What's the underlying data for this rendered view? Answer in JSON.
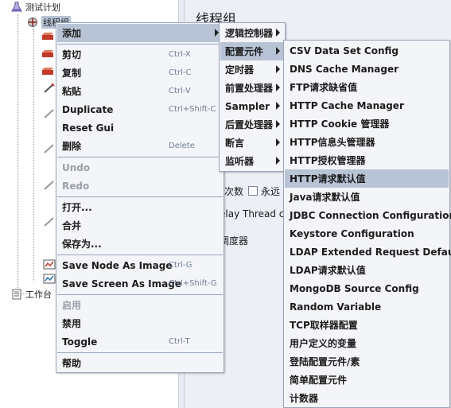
{
  "tree": {
    "items": [
      {
        "label": "测试计划",
        "icon": "test-plan-icon"
      },
      {
        "label": "线程组",
        "icon": "thread-group-icon"
      },
      {
        "label": "工作台",
        "icon": "workbench-icon"
      }
    ]
  },
  "right_panel": {
    "title": "线程组",
    "frag_loop_count": "次数",
    "frag_forever": "永远",
    "frag_delay": "elay Thread c",
    "frag_scheduler": "调度器"
  },
  "context_menu": {
    "items": [
      {
        "label": "添加",
        "submenu": true
      },
      {
        "label": "剪切",
        "shortcut": "Ctrl-X"
      },
      {
        "label": "复制",
        "shortcut": "Ctrl-C"
      },
      {
        "label": "粘贴",
        "shortcut": "Ctrl-V"
      },
      {
        "label": "Duplicate",
        "shortcut": "Ctrl+Shift-C"
      },
      {
        "label": "Reset Gui"
      },
      {
        "label": "删除",
        "shortcut": "Delete"
      },
      {
        "label": "Undo",
        "disabled": true
      },
      {
        "label": "Redo",
        "disabled": true
      },
      {
        "label": "打开..."
      },
      {
        "label": "合并"
      },
      {
        "label": "保存为..."
      },
      {
        "label": "Save Node As Image",
        "shortcut": "Ctrl-G"
      },
      {
        "label": "Save Screen As Image",
        "shortcut": "Ctrl+Shift-G"
      },
      {
        "label": "启用",
        "disabled": true
      },
      {
        "label": "禁用"
      },
      {
        "label": "Toggle",
        "shortcut": "Ctrl-T"
      },
      {
        "label": "帮助"
      }
    ]
  },
  "add_menu": {
    "items": [
      {
        "label": "逻辑控制器"
      },
      {
        "label": "配置元件",
        "highlighted": true
      },
      {
        "label": "定时器"
      },
      {
        "label": "前置处理器"
      },
      {
        "label": "Sampler"
      },
      {
        "label": "后置处理器"
      },
      {
        "label": "断言"
      },
      {
        "label": "监听器"
      }
    ]
  },
  "config_menu": {
    "items": [
      {
        "label": "CSV Data Set Config"
      },
      {
        "label": "DNS Cache Manager"
      },
      {
        "label": "FTP请求缺省值"
      },
      {
        "label": "HTTP Cache Manager"
      },
      {
        "label": "HTTP Cookie 管理器"
      },
      {
        "label": "HTTP信息头管理器"
      },
      {
        "label": "HTTP授权管理器"
      },
      {
        "label": "HTTP请求默认值",
        "highlighted": true
      },
      {
        "label": "Java请求默认值"
      },
      {
        "label": "JDBC Connection Configuration"
      },
      {
        "label": "Keystore Configuration"
      },
      {
        "label": "LDAP Extended Request Defaults"
      },
      {
        "label": "LDAP请求默认值"
      },
      {
        "label": "MongoDB Source Config"
      },
      {
        "label": "Random Variable"
      },
      {
        "label": "TCP取样器配置"
      },
      {
        "label": "用户定义的变量"
      },
      {
        "label": "登陆配置元件/素"
      },
      {
        "label": "简单配置元件"
      },
      {
        "label": "计数器"
      }
    ]
  },
  "colors": {
    "menu_bg": "#f4f5f8",
    "menu_border": "#98a6bd",
    "highlight": "#b8c4d6",
    "shortcut": "#6f7d97",
    "disabled": "#9aa0aa",
    "panel_bg": "#eceff5"
  }
}
